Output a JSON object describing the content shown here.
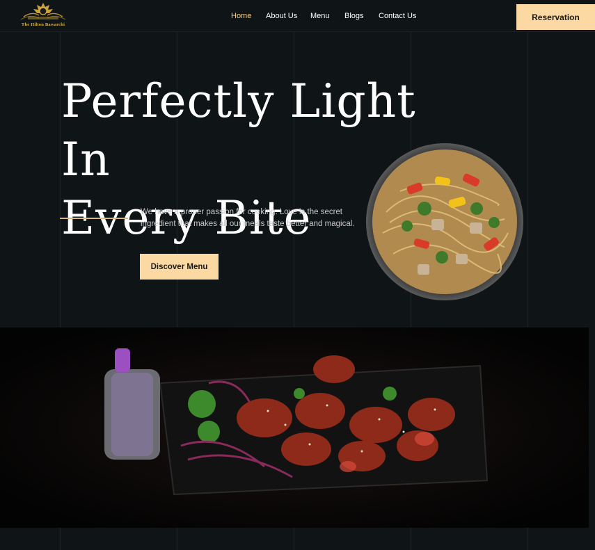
{
  "header": {
    "logo_text": "The Hilton Bawarchi",
    "nav": [
      {
        "label": "Home",
        "active": true
      },
      {
        "label": "About Us",
        "active": false
      },
      {
        "label": "Menu",
        "active": false
      },
      {
        "label": "Blogs",
        "active": false
      },
      {
        "label": "Contact Us",
        "active": false
      }
    ],
    "reservation_label": "Reservation"
  },
  "hero": {
    "title_line1": "Perfectly Light In",
    "title_line2": "Every Bite",
    "description": "We have a proper passion for cooking. Love is the secret ingredient that makes all our meals taste better and magical.",
    "cta_label": "Discover Menu"
  },
  "colors": {
    "background": "#0f1416",
    "accent": "#fcd9a2",
    "active_nav": "#f5d08a",
    "logo_gold": "#d9b44a"
  }
}
